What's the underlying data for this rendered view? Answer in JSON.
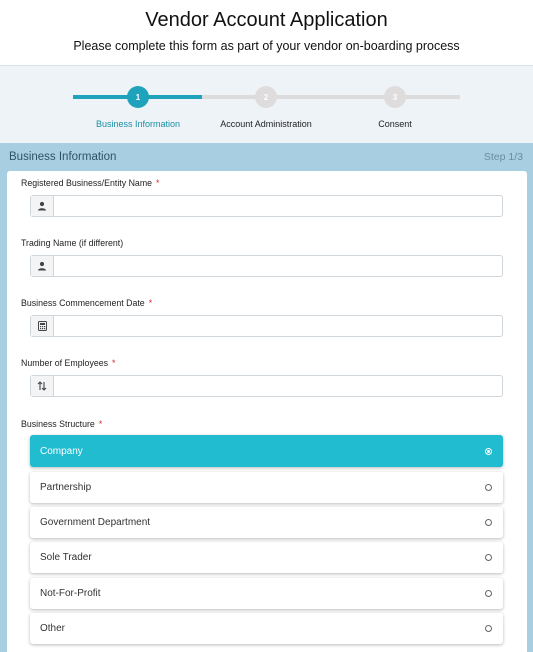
{
  "header": {
    "title": "Vendor Account Application",
    "subtitle": "Please complete this form as part of your vendor on-boarding process"
  },
  "wizard": {
    "progress": 0.5,
    "steps": [
      {
        "number": "1",
        "label": "Business Information",
        "active": true
      },
      {
        "number": "2",
        "label": "Account Administration",
        "active": false
      },
      {
        "number": "3",
        "label": "Consent",
        "active": false
      }
    ]
  },
  "panel": {
    "title": "Business Information",
    "step_text": "Step 1/3"
  },
  "form": {
    "fields": [
      {
        "label": "Registered Business/Entity Name",
        "required": "*",
        "icon": "user-icon",
        "value": ""
      },
      {
        "label": "Trading Name (if different)",
        "required": "",
        "icon": "user-icon",
        "value": ""
      },
      {
        "label": "Business Commencement Date",
        "required": "*",
        "icon": "calculator-icon",
        "value": ""
      },
      {
        "label": "Number of Employees",
        "required": "*",
        "icon": "sort-arrows-icon",
        "value": ""
      }
    ],
    "business_structure": {
      "label": "Business Structure",
      "required": "*",
      "selected": "Company",
      "options": [
        "Company",
        "Partnership",
        "Government Department",
        "Sole Trader",
        "Not-For-Profit",
        "Other"
      ]
    }
  },
  "colors": {
    "accent": "#1fa3bc",
    "selected_option": "#22bcd1",
    "panel_bg": "#a8cfe1",
    "required": "#d8262e"
  }
}
